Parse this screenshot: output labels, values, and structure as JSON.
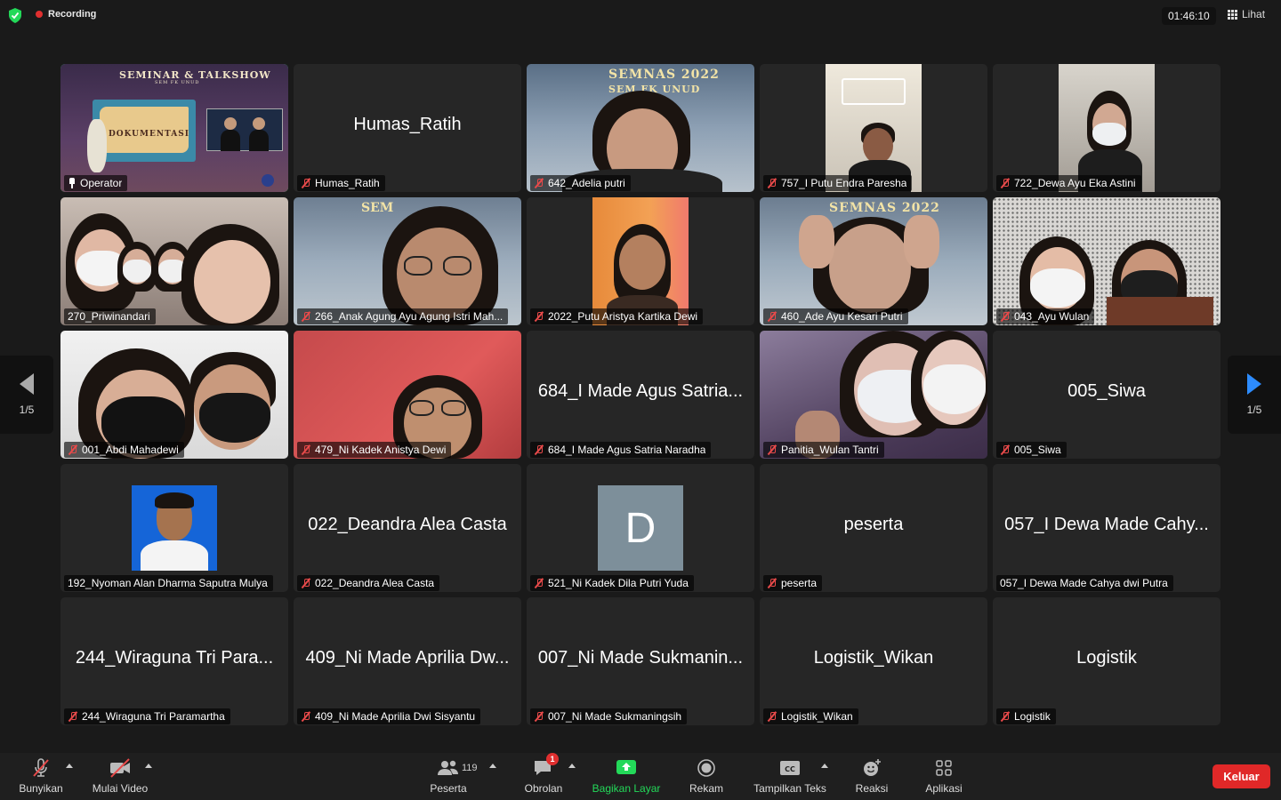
{
  "status": {
    "recording_label": "Recording",
    "clock": "01:46:10",
    "view_label": "Lihat"
  },
  "pager": {
    "left_label": "1/5",
    "right_label": "1/5"
  },
  "tiles": [
    {
      "label": "Operator",
      "big": "",
      "type": "video",
      "icon": "pin-icon",
      "active": true
    },
    {
      "label": "Humas_Ratih",
      "big": "Humas_Ratih",
      "type": "name",
      "icon": "mic-muted-icon"
    },
    {
      "label": "642_Adelia putri",
      "big": "",
      "type": "video",
      "icon": "mic-muted-icon"
    },
    {
      "label": "757_I Putu Endra Paresha",
      "big": "",
      "type": "video",
      "icon": "mic-muted-icon"
    },
    {
      "label": "722_Dewa Ayu Eka Astini",
      "big": "",
      "type": "video",
      "icon": "mic-muted-icon"
    },
    {
      "label": "270_Priwinandari",
      "big": "",
      "type": "video",
      "icon": ""
    },
    {
      "label": "266_Anak Agung Ayu Agung Istri Mah...",
      "big": "",
      "type": "video",
      "icon": "mic-muted-icon"
    },
    {
      "label": "2022_Putu Aristya Kartika Dewi",
      "big": "",
      "type": "video",
      "icon": "mic-muted-icon"
    },
    {
      "label": "460_Ade Ayu Kesari Putri",
      "big": "",
      "type": "video",
      "icon": "mic-muted-icon"
    },
    {
      "label": "043_Ayu Wulan",
      "big": "",
      "type": "video",
      "icon": "mic-muted-icon"
    },
    {
      "label": "001_Abdi Mahadewi",
      "big": "",
      "type": "video",
      "icon": "mic-muted-icon"
    },
    {
      "label": "479_Ni Kadek Anistya Dewi",
      "big": "",
      "type": "video",
      "icon": "mic-muted-icon"
    },
    {
      "label": "684_I Made Agus Satria Naradha",
      "big": "684_I Made Agus Satria...",
      "type": "name",
      "icon": "mic-muted-icon"
    },
    {
      "label": "Panitia_Wulan Tantri",
      "big": "",
      "type": "video",
      "icon": "mic-muted-icon"
    },
    {
      "label": "005_Siwa",
      "big": "005_Siwa",
      "type": "name",
      "icon": "mic-muted-icon"
    },
    {
      "label": "192_Nyoman Alan Dharma Saputra Mulya",
      "big": "",
      "type": "photo",
      "icon": ""
    },
    {
      "label": "022_Deandra Alea Casta",
      "big": "022_Deandra Alea Casta",
      "type": "name",
      "icon": "mic-muted-icon"
    },
    {
      "label": "521_Ni Kadek Dila Putri Yuda",
      "big": "D",
      "type": "letter",
      "icon": "mic-muted-icon"
    },
    {
      "label": "peserta",
      "big": "peserta",
      "type": "name",
      "icon": "mic-muted-icon"
    },
    {
      "label": "057_I Dewa Made Cahya dwi Putra",
      "big": "057_I Dewa Made Cahy...",
      "type": "name",
      "icon": ""
    },
    {
      "label": "244_Wiraguna Tri Paramartha",
      "big": "244_Wiraguna Tri Para...",
      "type": "name",
      "icon": "mic-muted-icon"
    },
    {
      "label": "409_Ni Made Aprilia Dwi Sisyantu",
      "big": "409_Ni Made Aprilia Dw...",
      "type": "name",
      "icon": "mic-muted-icon"
    },
    {
      "label": "007_Ni Made Sukmaningsih",
      "big": "007_Ni Made Sukmanin...",
      "type": "name",
      "icon": "mic-muted-icon"
    },
    {
      "label": "Logistik_Wikan",
      "big": "Logistik_Wikan",
      "type": "name",
      "icon": "mic-muted-icon"
    },
    {
      "label": "Logistik",
      "big": "Logistik",
      "type": "name",
      "icon": "mic-muted-icon"
    }
  ],
  "banner": {
    "seminar_title": "SEMINAR & TALKSHOW",
    "seminar_sub": "SEM FK UNUD",
    "dokumentasi": "DOKUMENTASI",
    "semnas_title": "SEMNAS 2022",
    "semnas_sub": "SEM FK UNUD"
  },
  "toolbar": {
    "unmute": "Bunyikan",
    "start_video": "Mulai Video",
    "participants": "Peserta",
    "participants_count": "119",
    "chat": "Obrolan",
    "chat_badge": "1",
    "share": "Bagikan Layar",
    "record": "Rekam",
    "captions": "Tampilkan Teks",
    "reactions": "Reaksi",
    "apps": "Aplikasi",
    "leave": "Keluar"
  },
  "colors": {
    "accent_green": "#23d959",
    "leave_red": "#e02828",
    "accent_blue": "#2d8cff"
  }
}
